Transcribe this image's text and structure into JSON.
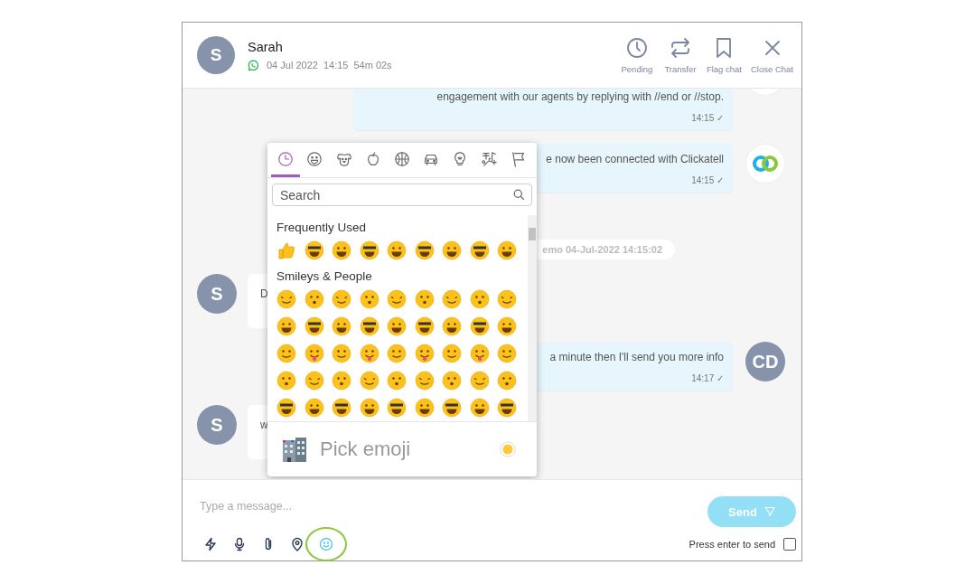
{
  "header": {
    "avatar": "S",
    "name": "Sarah",
    "date": "04 Jul 2022",
    "time": "14:15",
    "duration": "54m 02s",
    "actions": [
      {
        "kind": "clock",
        "label": "Pending"
      },
      {
        "kind": "transfer",
        "label": "Transfer"
      },
      {
        "kind": "bookmark",
        "label": "Flag chat"
      },
      {
        "kind": "close",
        "label": "Close Chat"
      }
    ]
  },
  "messages": [
    {
      "kind": "outgoing",
      "text": "engagement with our agents by replying with //end or //stop.",
      "time": "14:15 ✓"
    },
    {
      "kind": "outgoing",
      "text": "e now been connected with Clickatell",
      "time": "14:15 ✓"
    },
    {
      "kind": "system",
      "text": "emo 04-Jul-2022 14:15:02"
    },
    {
      "kind": "incoming",
      "text": "D",
      "avatar": "S"
    },
    {
      "kind": "outgoing",
      "text": "a minute then I'll send you more info",
      "time": "14:17 ✓",
      "avatar": "CD"
    },
    {
      "kind": "incoming",
      "text": "w",
      "avatar": "S"
    }
  ],
  "emoji_picker": {
    "tabs": [
      {
        "kind": "recent",
        "selected": true
      },
      {
        "kind": "smileys",
        "selected": false
      },
      {
        "kind": "animals",
        "selected": false
      },
      {
        "kind": "food",
        "selected": false
      },
      {
        "kind": "activity",
        "selected": false
      },
      {
        "kind": "travel",
        "selected": false
      },
      {
        "kind": "objects",
        "selected": false
      },
      {
        "kind": "symbols",
        "selected": false
      },
      {
        "kind": "flags",
        "selected": false
      }
    ],
    "search": {
      "placeholder": "Search"
    },
    "sections": [
      {
        "title": "Frequently Used"
      },
      {
        "title": "Smileys & People"
      }
    ],
    "preview": "Pick emoji"
  },
  "composer": {
    "placeholder": "Type a message...",
    "send": "Send",
    "tools": [
      {
        "kind": "bolt",
        "selected": false
      },
      {
        "kind": "mic",
        "selected": false
      },
      {
        "kind": "clip",
        "selected": false
      },
      {
        "kind": "pin",
        "selected": false
      },
      {
        "kind": "emoji",
        "selected": true
      }
    ],
    "enter_to_send": {
      "label": "Press enter to send",
      "checked": false
    }
  }
}
